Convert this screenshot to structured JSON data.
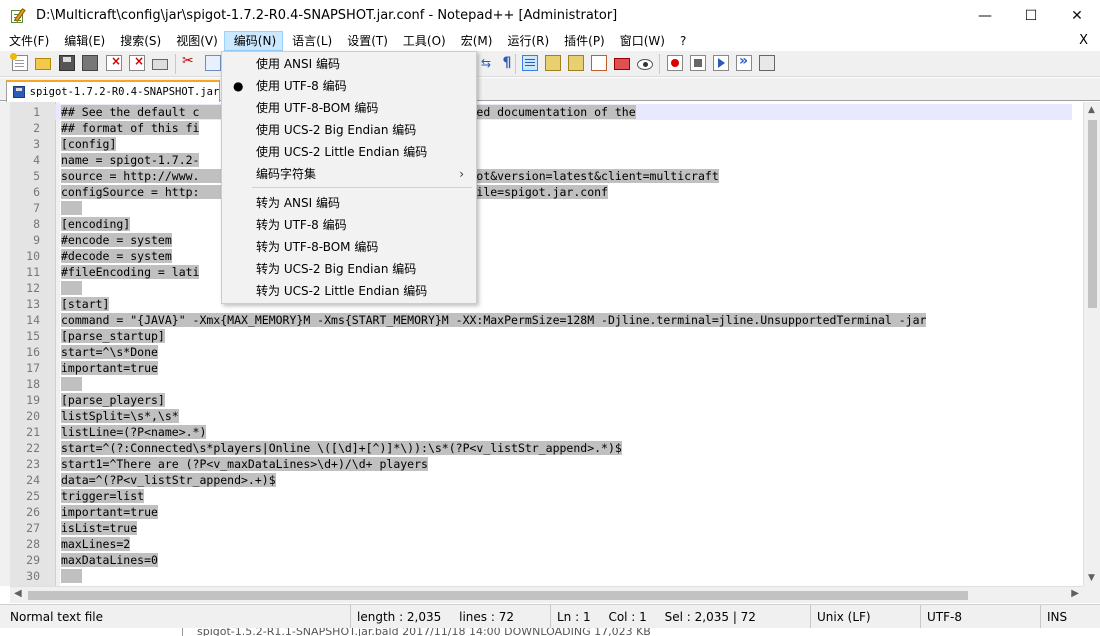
{
  "window": {
    "title": "D:\\Multicraft\\config\\jar\\spigot-1.7.2-R0.4-SNAPSHOT.jar.conf - Notepad++ [Administrator]",
    "minimize": "—",
    "maximize": "☐",
    "close": "✕"
  },
  "menubar": {
    "items": [
      "文件(F)",
      "编辑(E)",
      "搜索(S)",
      "视图(V)",
      "编码(N)",
      "语言(L)",
      "设置(T)",
      "工具(O)",
      "宏(M)",
      "运行(R)",
      "插件(P)",
      "窗口(W)",
      "?"
    ],
    "close": "X"
  },
  "toolbar": {
    "paragraph_glyph": "¶",
    "brace_glyph": "⇆"
  },
  "tab": {
    "label": "spigot-1.7.2-R0.4-SNAPSHOT.jar."
  },
  "editor": {
    "lines": [
      {
        "n": "1",
        "text": "## See the default c                                        ed documentation of the"
      },
      {
        "n": "2",
        "text": "## format of this fi"
      },
      {
        "n": "3",
        "text": "[config]"
      },
      {
        "n": "4",
        "text": "name = spigot-1.7.2-"
      },
      {
        "n": "5",
        "text": "source = http://www.                                  e=spigot&version=latest&client=multicraft"
      },
      {
        "n": "6",
        "text": "configSource = http:                                   nf/?file=spigot.jar.conf"
      },
      {
        "n": "7",
        "text": ""
      },
      {
        "n": "8",
        "text": "[encoding]"
      },
      {
        "n": "9",
        "text": "#encode = system"
      },
      {
        "n": "10",
        "text": "#decode = system"
      },
      {
        "n": "11",
        "text": "#fileEncoding = lati"
      },
      {
        "n": "12",
        "text": ""
      },
      {
        "n": "13",
        "text": "[start]"
      },
      {
        "n": "14",
        "text": "command = \"{JAVA}\" -Xmx{MAX_MEMORY}M -Xms{START_MEMORY}M -XX:MaxPermSize=128M -Djline.terminal=jline.UnsupportedTerminal -jar"
      },
      {
        "n": "15",
        "text": "[parse_startup]"
      },
      {
        "n": "16",
        "text": "start=^\\s*Done"
      },
      {
        "n": "17",
        "text": "important=true"
      },
      {
        "n": "18",
        "text": ""
      },
      {
        "n": "19",
        "text": "[parse_players]"
      },
      {
        "n": "20",
        "text": "listSplit=\\s*,\\s*"
      },
      {
        "n": "21",
        "text": "listLine=(?P<name>.*)"
      },
      {
        "n": "22",
        "text": "start=^(?:Connected\\s*players|Online \\([\\d]+[^)]*\\)):\\s*(?P<v_listStr_append>.*)$"
      },
      {
        "n": "23",
        "text": "start1=^There are (?P<v_maxDataLines>\\d+)/\\d+ players"
      },
      {
        "n": "24",
        "text": "data=^(?P<v_listStr_append>.+)$"
      },
      {
        "n": "25",
        "text": "trigger=list"
      },
      {
        "n": "26",
        "text": "important=true"
      },
      {
        "n": "27",
        "text": "isList=true"
      },
      {
        "n": "28",
        "text": "maxLines=2"
      },
      {
        "n": "29",
        "text": "maxDataLines=0"
      },
      {
        "n": "30",
        "text": ""
      }
    ]
  },
  "dropdown": {
    "items": [
      {
        "label": "使用 ANSI 编码",
        "bullet": "",
        "arrow": ""
      },
      {
        "label": "使用 UTF-8 编码",
        "bullet": "●",
        "arrow": ""
      },
      {
        "label": "使用 UTF-8-BOM 编码",
        "bullet": "",
        "arrow": ""
      },
      {
        "label": "使用 UCS-2 Big Endian 编码",
        "bullet": "",
        "arrow": ""
      },
      {
        "label": "使用 UCS-2 Little Endian 编码",
        "bullet": "",
        "arrow": ""
      },
      {
        "label": "编码字符集",
        "bullet": "",
        "arrow": "›"
      },
      {
        "label": "转为 ANSI 编码",
        "bullet": "",
        "arrow": ""
      },
      {
        "label": "转为 UTF-8 编码",
        "bullet": "",
        "arrow": ""
      },
      {
        "label": "转为 UTF-8-BOM 编码",
        "bullet": "",
        "arrow": ""
      },
      {
        "label": "转为 UCS-2 Big Endian 编码",
        "bullet": "",
        "arrow": ""
      },
      {
        "label": "转为 UCS-2 Little Endian 编码",
        "bullet": "",
        "arrow": ""
      }
    ]
  },
  "statusbar": {
    "type": "Normal text file",
    "length": "length : 2,035",
    "lines": "lines : 72",
    "ln": "Ln : 1",
    "col": "Col : 1",
    "sel": "Sel : 2,035 | 72",
    "eol": "Unix (LF)",
    "encoding": "UTF-8",
    "mode": "INS"
  },
  "behind": {
    "text": "spigot-1.5.2-R1.1-SNAPSHOT.jar.bald     2017/11/18 14:00     DOWNLOADING     17,023 KB"
  },
  "colors": {
    "selection": "#c0c0c0",
    "menu_hover": "#91c9f7",
    "active_menu": "#cce8ff",
    "tab_accent": "#f6a623"
  }
}
